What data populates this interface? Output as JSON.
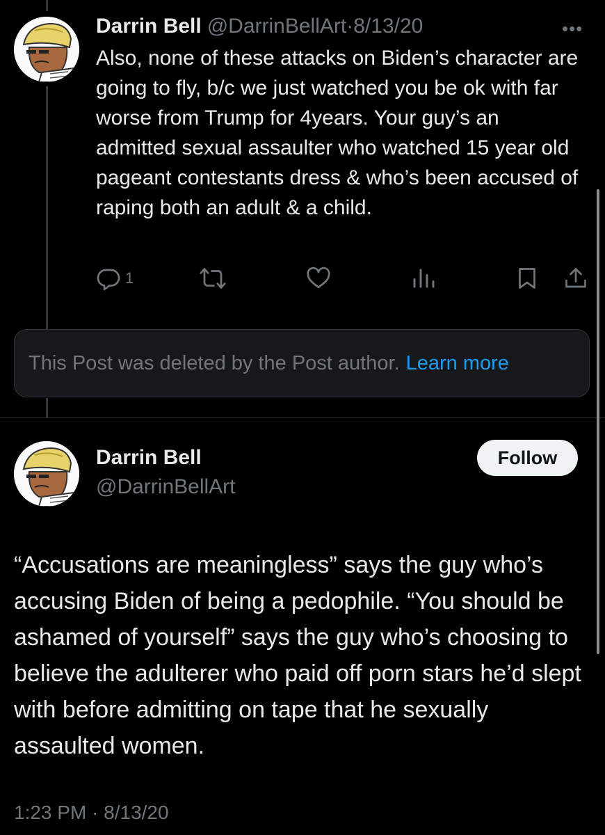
{
  "reply": {
    "name": "Darrin Bell",
    "handle": "@DarrinBellArt",
    "separator": "·",
    "date": "8/13/20",
    "more_icon": "more-dots-icon",
    "text": "Also, none of these attacks on Biden’s character are going to fly, b/c we just watched you be ok with far worse from Trump for 4years. Your guy’s an admitted sexual assaulter who watched 15 year old pageant contestants dress & who’s been accused of raping both an adult & a child.",
    "actions": {
      "reply_count": "1",
      "icons": [
        "reply-icon",
        "repost-icon",
        "like-icon",
        "views-icon",
        "bookmark-icon",
        "share-icon"
      ]
    }
  },
  "deleted_notice": {
    "message": "This Post was deleted by the Post author.",
    "link": "Learn more"
  },
  "main_post": {
    "name": "Darrin Bell",
    "handle": "@DarrinBellArt",
    "follow_label": "Follow",
    "text": "“Accusations are meaningless” says the guy who’s accusing Biden of being a pedophile. “You should be ashamed of yourself” says the guy who’s choosing to believe the adulterer who paid off porn stars he’d slept with before admitting on tape that he sexually assaulted women.",
    "timestamp": "1:23 PM · 8/13/20"
  },
  "colors": {
    "background": "#000000",
    "text": "#e7e9ea",
    "muted": "#71767b",
    "link": "#1d9bf0",
    "follow_bg": "#eff3f4"
  }
}
